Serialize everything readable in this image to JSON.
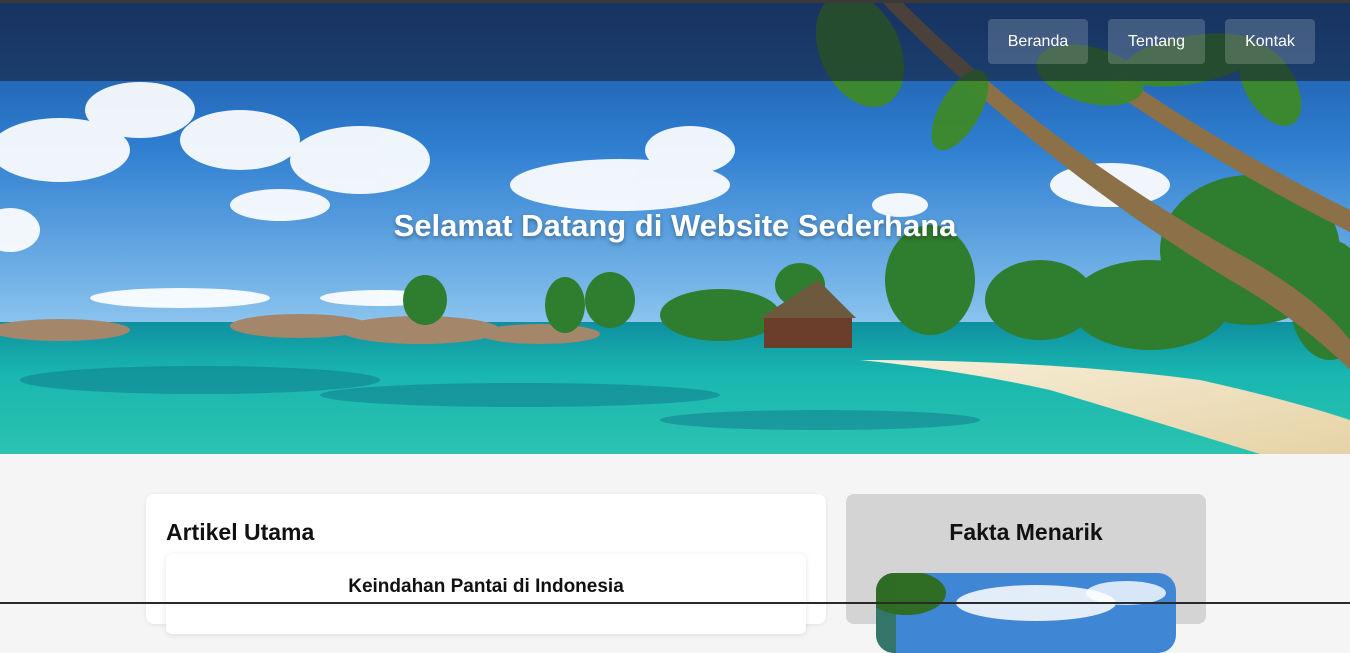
{
  "nav": {
    "items": [
      {
        "label": "Beranda"
      },
      {
        "label": "Tentang"
      },
      {
        "label": "Kontak"
      }
    ]
  },
  "hero": {
    "title": "Selamat Datang di Website Sederhana"
  },
  "main": {
    "title": "Artikel Utama",
    "article": {
      "title": "Keindahan Pantai di Indonesia"
    }
  },
  "sidebar": {
    "title": "Fakta Menarik"
  },
  "colors": {
    "sky": "#2f7fd1",
    "sea": "#19b7b0",
    "sand": "#f2e6c9",
    "card": "#ffffff",
    "side_card": "#d4d4d4"
  }
}
